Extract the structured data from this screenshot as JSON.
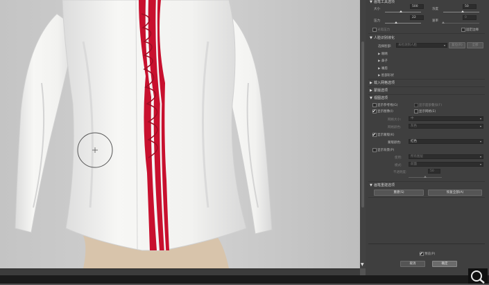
{
  "brush_tool": {
    "header": "画笔工具选项",
    "size_label": "大小",
    "size_value": "500",
    "density_label": "浓度",
    "density_value": "50",
    "pressure_label": "压力",
    "pressure_value": "22",
    "rate_label": "速率",
    "rate_value": "0",
    "stylus_label": "光笔压力",
    "pin_edges_label": "固定边缘"
  },
  "face_aware": {
    "header": "人脸识别液化",
    "select_face_label": "选择脸部:",
    "select_face_value": "未检测到人脸",
    "reset_label": "复位(R)",
    "all_label": "全部",
    "items": [
      "眼睛",
      "鼻子",
      "嘴唇",
      "脸部形状"
    ]
  },
  "load_mesh": {
    "header": "载入网格选项"
  },
  "mask": {
    "header": "蒙版选项"
  },
  "view": {
    "header": "视图选项",
    "show_guides": "显示参考线(G)",
    "show_face_overlay": "显示面部叠加(F)",
    "show_image": "显示图像(I)",
    "show_mesh": "显示网格(E)",
    "mesh_size_label": "网格大小:",
    "mesh_size_value": "中",
    "mesh_color_label": "网格颜色:",
    "mesh_color_value": "灰色",
    "show_mask": "显示蒙版(K)",
    "mask_color_label": "蒙版颜色:",
    "mask_color_value": "红色",
    "show_backdrop": "显示背景(P)",
    "use_label": "使用:",
    "use_value": "所有图层",
    "mode_label": "模式:",
    "mode_value": "前面",
    "opacity_label": "不透明度:",
    "opacity_value": "50"
  },
  "reconstruct": {
    "header": "画笔重建选项",
    "rebuild_label": "重建(S)",
    "restore_all_label": "恢复全部(A)"
  },
  "footer": {
    "preview_label": "预览(P)",
    "cancel_label": "取消",
    "ok_label": "确定"
  },
  "colors": {
    "panel_bg": "#3f3f3f",
    "field_bg": "#2d2d2d",
    "shirt": "#f2f2f0",
    "ruffle_red": "#c8102e"
  }
}
